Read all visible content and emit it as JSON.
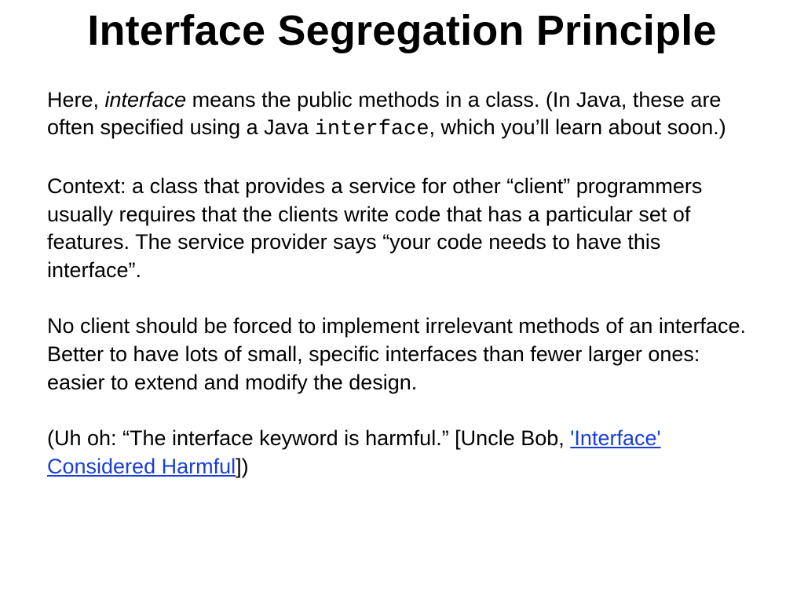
{
  "title": "Interface Segregation Principle",
  "p1": {
    "t1": "Here, ",
    "em": "interface",
    "t2": " means the public methods in a class. (In Java, these are often specified using a Java ",
    "code": "interface",
    "t3": ", which you’ll learn about soon.)"
  },
  "p2": "Context: a class that provides a service for other “client” programmers usually requires that the clients write code that has a particular set of features. The service provider says “your code needs to have this interface”.",
  "p3": "No client should be forced to implement irrelevant methods of an interface. Better to have lots of small, specific interfaces than fewer larger ones: easier to extend and modify the design.",
  "p4": {
    "t1": "(Uh oh: “The interface keyword is harmful.” [Uncle Bob, ",
    "link": "'Interface' Considered Harmful",
    "t2": "])"
  }
}
